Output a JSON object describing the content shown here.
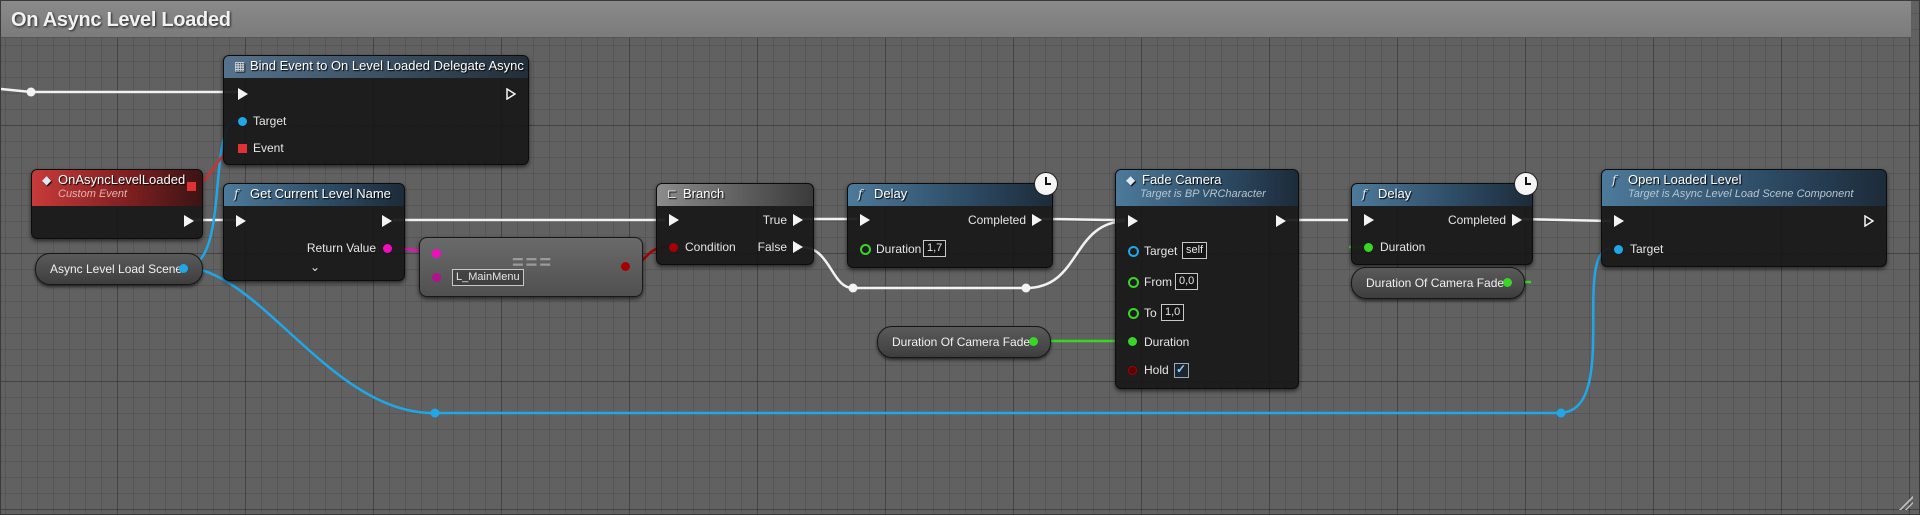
{
  "comment": {
    "title": "On Async Level Loaded"
  },
  "nodes": {
    "custom_event": {
      "title": "OnAsyncLevelLoaded",
      "subtitle": "Custom Event"
    },
    "bind_event": {
      "title": "Bind Event to On Level Loaded Delegate Async",
      "target_label": "Target",
      "event_label": "Event"
    },
    "get_level_name": {
      "title": "Get Current Level Name",
      "return_label": "Return Value",
      "expand_icon": "chevron-down-icon"
    },
    "equals": {
      "symbol": "===",
      "string_value": "L_MainMenu"
    },
    "branch": {
      "title": "Branch",
      "condition_label": "Condition",
      "true_label": "True",
      "false_label": "False"
    },
    "delay1": {
      "title": "Delay",
      "completed_label": "Completed",
      "duration_label": "Duration",
      "duration_value": "1,7"
    },
    "fade_camera": {
      "title": "Fade Camera",
      "subtitle": "Target is BP VRCharacter",
      "target_label": "Target",
      "target_value": "self",
      "from_label": "From",
      "from_value": "0,0",
      "to_label": "To",
      "to_value": "1,0",
      "duration_label": "Duration",
      "hold_label": "Hold",
      "hold_checked": true
    },
    "delay2": {
      "title": "Delay",
      "completed_label": "Completed",
      "duration_label": "Duration"
    },
    "open_level": {
      "title": "Open Loaded Level",
      "subtitle": "Target is Async Level Load Scene Component",
      "target_label": "Target"
    }
  },
  "variables": {
    "async_scene": "Async Level Load Scene",
    "fade_duration_1": "Duration Of Camera Fade",
    "fade_duration_2": "Duration Of Camera Fade"
  },
  "colors": {
    "exec": "#f4f4f4",
    "object_pin": "#1fa7e8",
    "string_pin": "#f20cbd",
    "bool_pin": "#a80000",
    "float_pin": "#39d628",
    "delegate_pin": "#e03232"
  }
}
